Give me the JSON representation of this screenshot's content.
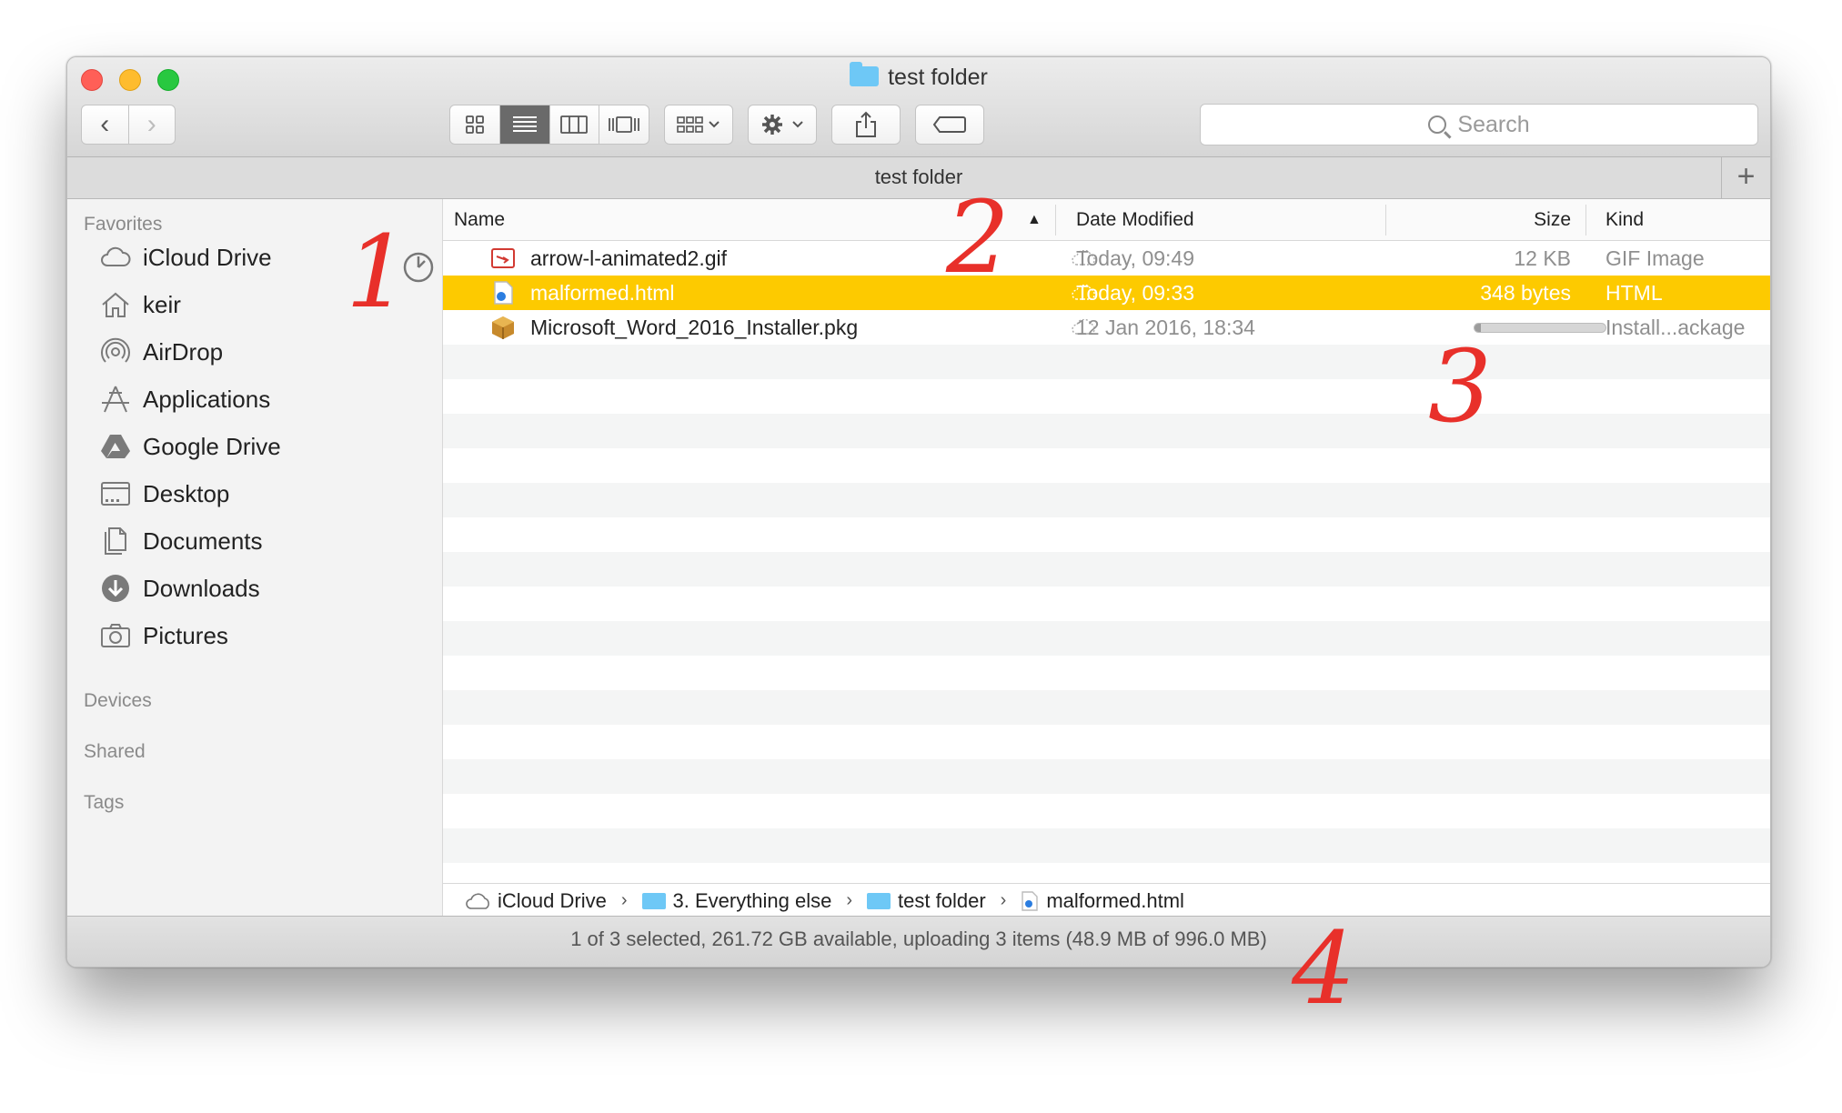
{
  "window": {
    "title": "test folder"
  },
  "toolbar": {
    "back": "‹",
    "forward": "›",
    "search_placeholder": "Search"
  },
  "tab": {
    "title": "test folder",
    "add": "+"
  },
  "sidebar": {
    "favorites_heading": "Favorites",
    "items": [
      {
        "label": "iCloud Drive",
        "icon": "cloud-icon"
      },
      {
        "label": "keir",
        "icon": "home-icon"
      },
      {
        "label": "AirDrop",
        "icon": "airdrop-icon"
      },
      {
        "label": "Applications",
        "icon": "applications-icon"
      },
      {
        "label": "Google Drive",
        "icon": "google-drive-icon"
      },
      {
        "label": "Desktop",
        "icon": "desktop-icon"
      },
      {
        "label": "Documents",
        "icon": "documents-icon"
      },
      {
        "label": "Downloads",
        "icon": "downloads-icon"
      },
      {
        "label": "Pictures",
        "icon": "camera-icon"
      }
    ],
    "devices_heading": "Devices",
    "shared_heading": "Shared",
    "tags_heading": "Tags"
  },
  "columns": {
    "name": "Name",
    "date": "Date Modified",
    "size": "Size",
    "kind": "Kind"
  },
  "files": [
    {
      "name": "arrow-l-animated2.gif",
      "date": "Today, 09:49",
      "size": "12 KB",
      "kind": "GIF Image",
      "icon": "gif-file-icon",
      "selected": false
    },
    {
      "name": "malformed.html",
      "date": "Today, 09:33",
      "size": "348 bytes",
      "kind": "HTML",
      "icon": "html-file-icon",
      "selected": true
    },
    {
      "name": "Microsoft_Word_2016_Installer.pkg",
      "date": "12 Jan 2016, 18:34",
      "size": "",
      "kind": "Install...ackage",
      "icon": "package-icon",
      "selected": false,
      "upload_progress": 0.05
    }
  ],
  "path": [
    {
      "label": "iCloud Drive",
      "icon": "cloud-icon"
    },
    {
      "label": "3. Everything else",
      "icon": "folder-icon"
    },
    {
      "label": "test folder",
      "icon": "folder-icon"
    },
    {
      "label": "malformed.html",
      "icon": "html-file-icon"
    }
  ],
  "status": "1 of 3 selected, 261.72 GB available, uploading 3 items (48.9 MB of 996.0 MB)",
  "annotations": [
    "1",
    "2",
    "3",
    "4"
  ],
  "colors": {
    "selection": "#fdca00",
    "annotation": "#e8302a",
    "folder": "#6ec8f6"
  }
}
